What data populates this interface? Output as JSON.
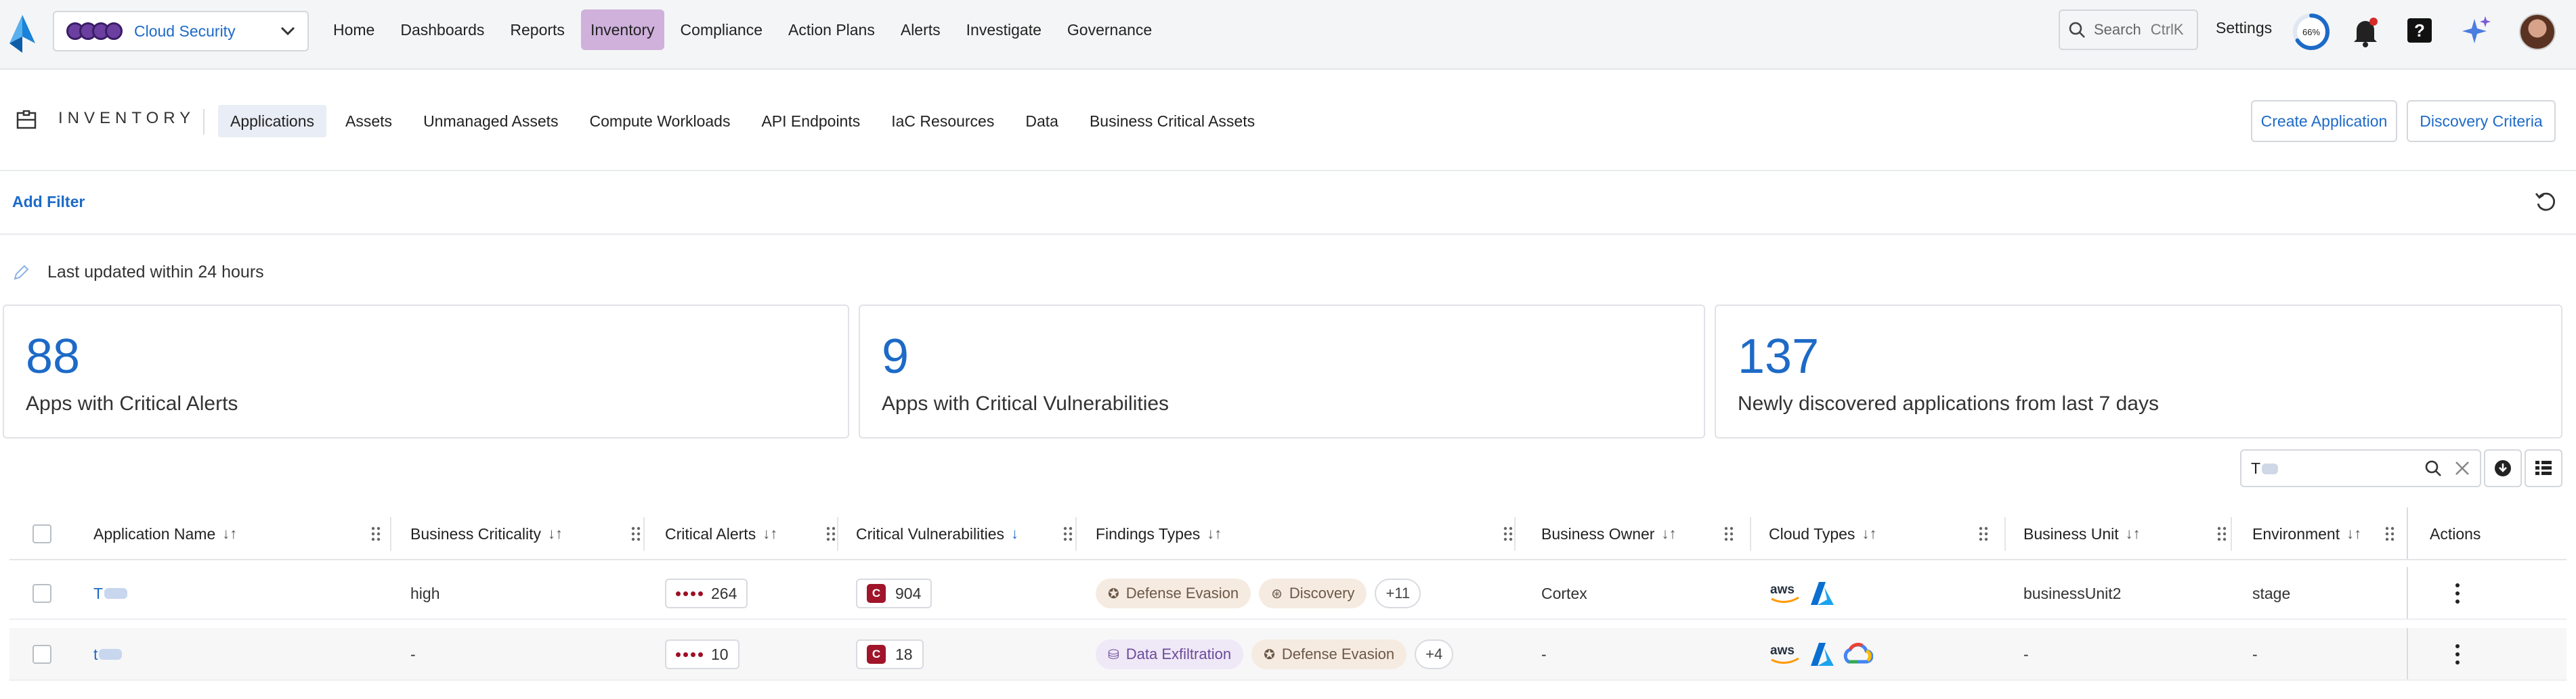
{
  "topbar": {
    "tenant": "Cloud Security",
    "nav": [
      "Home",
      "Dashboards",
      "Reports",
      "Inventory",
      "Compliance",
      "Action Plans",
      "Alerts",
      "Investigate",
      "Governance"
    ],
    "active_nav": "Inventory",
    "search_label": "Search",
    "search_shortcut": "CtrlK",
    "settings": "Settings",
    "progress": 0.66,
    "progress_label": "66%"
  },
  "inventory": {
    "title": "INVENTORY",
    "tabs": [
      "Applications",
      "Assets",
      "Unmanaged Assets",
      "Compute Workloads",
      "API Endpoints",
      "IaC Resources",
      "Data",
      "Business Critical Assets"
    ],
    "active_tab": "Applications",
    "create_button": "Create Application",
    "criteria_button": "Discovery Criteria"
  },
  "filter": {
    "add_filter": "Add Filter"
  },
  "last_updated": "Last updated within 24 hours",
  "stats": [
    {
      "value": "88",
      "label": "Apps with Critical Alerts"
    },
    {
      "value": "9",
      "label": "Apps with Critical Vulnerabilities"
    },
    {
      "value": "137",
      "label": "Newly discovered applications from last 7 days"
    }
  ],
  "table_search": {
    "value": "T"
  },
  "columns": [
    {
      "label": "Application Name"
    },
    {
      "label": "Business Criticality"
    },
    {
      "label": "Critical Alerts"
    },
    {
      "label": "Critical Vulnerabilities"
    },
    {
      "label": "Findings Types"
    },
    {
      "label": "Business Owner"
    },
    {
      "label": "Cloud Types"
    },
    {
      "label": "Business Unit"
    },
    {
      "label": "Environment"
    },
    {
      "label": "Actions"
    }
  ],
  "rows": [
    {
      "name": "T",
      "criticality": "high",
      "alerts": "264",
      "vulns": "904",
      "vuln_badge": "C",
      "findings": [
        {
          "label": "Defense Evasion",
          "style": "orange",
          "icon": "ninja-icon"
        },
        {
          "label": "Discovery",
          "style": "orange",
          "icon": "compass-icon"
        }
      ],
      "more": "+11",
      "owner": "Cortex",
      "clouds": [
        "aws",
        "azure"
      ],
      "unit": "businessUnit2",
      "env": "stage"
    },
    {
      "name": "t",
      "criticality": "-",
      "alerts": "10",
      "vulns": "18",
      "vuln_badge": "C",
      "findings": [
        {
          "label": "Data Exfiltration",
          "style": "purple",
          "icon": "database-icon"
        },
        {
          "label": "Defense Evasion",
          "style": "orange",
          "icon": "ninja-icon"
        }
      ],
      "more": "+4",
      "owner": "-",
      "clouds": [
        "aws",
        "azure",
        "gcp"
      ],
      "unit": "-",
      "env": "-"
    }
  ],
  "colors": {
    "accent": "#1d6ac7",
    "active_nav_bg": "#cfb1dc",
    "critical": "#a0152a"
  }
}
